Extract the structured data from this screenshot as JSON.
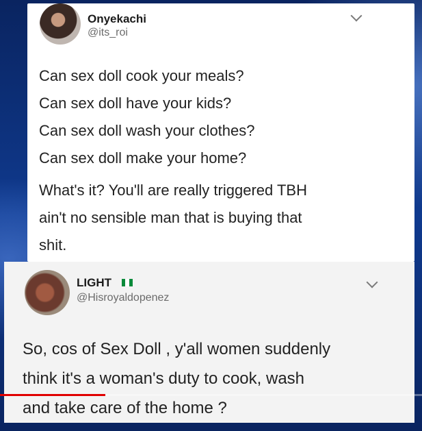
{
  "tweet1": {
    "name": "Onyekachi",
    "handle": "@its_roi",
    "lines": [
      "Can sex doll cook your meals?",
      "Can sex doll have your kids?",
      "Can sex doll wash your clothes?",
      "Can sex doll make your home?"
    ],
    "paragraph": [
      "What's it? You'll are really triggered TBH",
      "ain't no sensible man that is buying that",
      "shit."
    ]
  },
  "tweet2": {
    "name": "LIGHT",
    "handle": "@Hisroyaldopenez",
    "text": [
      "So, cos of Sex Doll , y'all women suddenly",
      "think it's a woman's duty to cook, wash",
      "and take care of the home ?"
    ]
  },
  "colors": {
    "flag_green": "#0a8a3a",
    "flag_white": "#ffffff",
    "progress": "#e00000"
  },
  "video": {
    "progress_fraction": 0.25
  }
}
